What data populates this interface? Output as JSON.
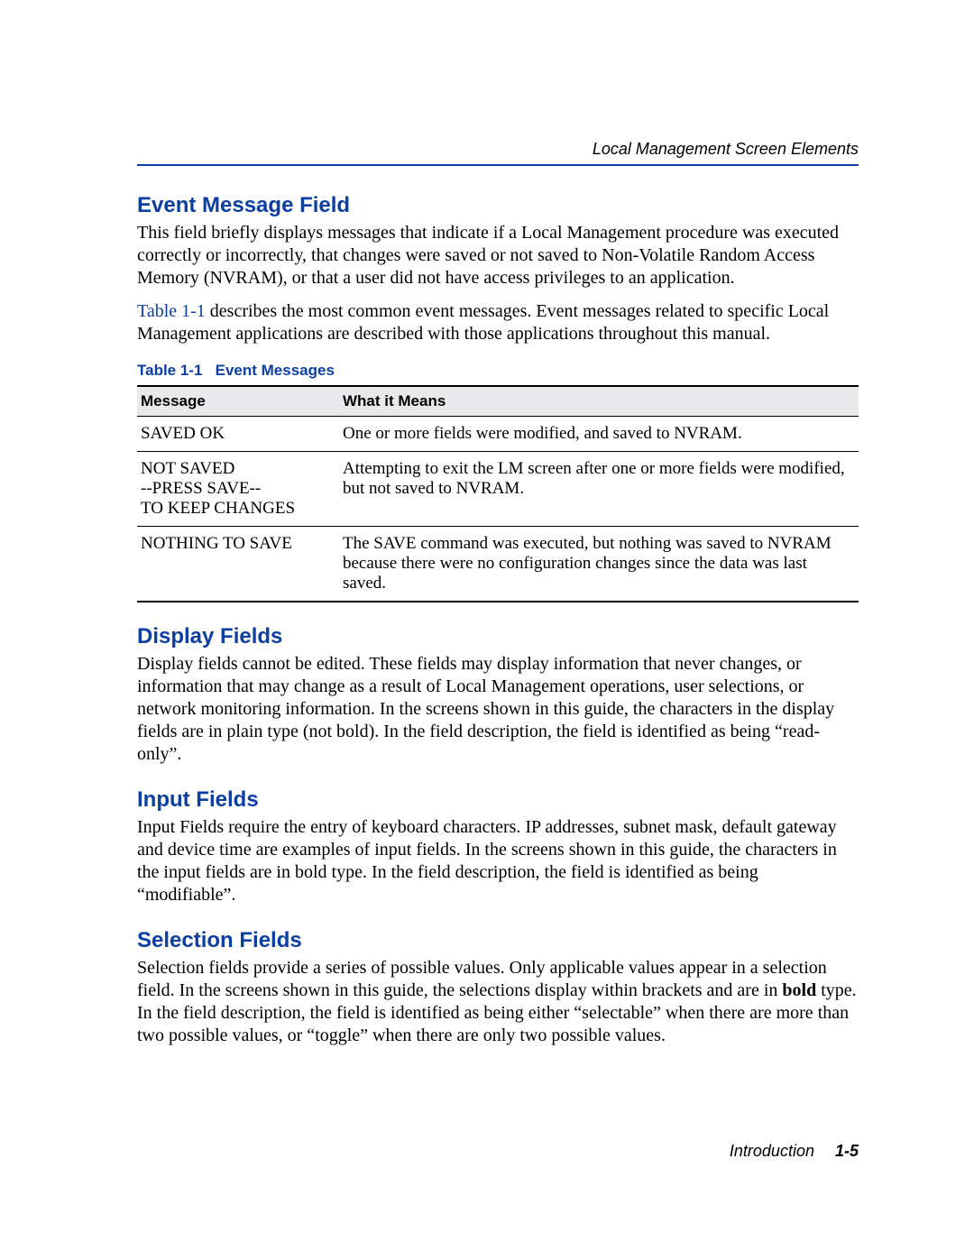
{
  "header": {
    "right_text": "Local Management Screen Elements"
  },
  "sections": {
    "event_message_field": {
      "heading": "Event Message Field",
      "para1": "This field briefly displays messages that indicate if a Local Management procedure was executed correctly or incorrectly, that changes were saved or not saved to Non-Volatile Random Access Memory (NVRAM), or that a user did not have access privileges to an application.",
      "para2_ref": "Table 1-1",
      "para2_rest": " describes the most common event messages. Event messages related to specific Local Management applications are described with those applications throughout this manual."
    },
    "display_fields": {
      "heading": "Display Fields",
      "para": "Display fields cannot be edited. These fields may display information that never changes, or information that may change as a result of Local Management operations, user selections, or network monitoring information. In the screens shown in this guide, the characters in the display fields are in plain type (not bold). In the field description, the field is identified as being “read-only”."
    },
    "input_fields": {
      "heading": "Input Fields",
      "para": "Input Fields require the entry of keyboard characters. IP addresses, subnet  mask, default gateway and device time are examples of input fields. In the screens shown in this guide, the characters in the input fields are in bold type. In the field description, the field is identified as being “modifiable”."
    },
    "selection_fields": {
      "heading": "Selection Fields",
      "para_pre": "Selection fields provide a series of possible values. Only applicable values appear in a selection field. In the screens shown in this guide, the selections display within brackets and are in ",
      "para_bold": "bold",
      "para_post": " type. In the field description, the field is identified as being either “selectable” when there are more than two possible values, or “toggle” when there are only two possible values."
    }
  },
  "table": {
    "caption_label": "Table 1-1",
    "caption_title": "Event Messages",
    "headers": {
      "c1": "Message",
      "c2": "What it Means"
    },
    "rows": [
      {
        "msg": "SAVED OK",
        "meaning": "One or more fields were modified, and saved to NVRAM."
      },
      {
        "msg": "NOT SAVED\n--PRESS SAVE--\nTO KEEP CHANGES",
        "meaning": "Attempting to exit the LM screen after one or more fields were modified, but not saved to NVRAM."
      },
      {
        "msg": "NOTHING TO SAVE",
        "meaning": "The SAVE command was executed, but nothing was saved to NVRAM because there were no configuration changes since the data was last saved."
      }
    ]
  },
  "footer": {
    "chapter": "Introduction",
    "page": "1-5"
  }
}
